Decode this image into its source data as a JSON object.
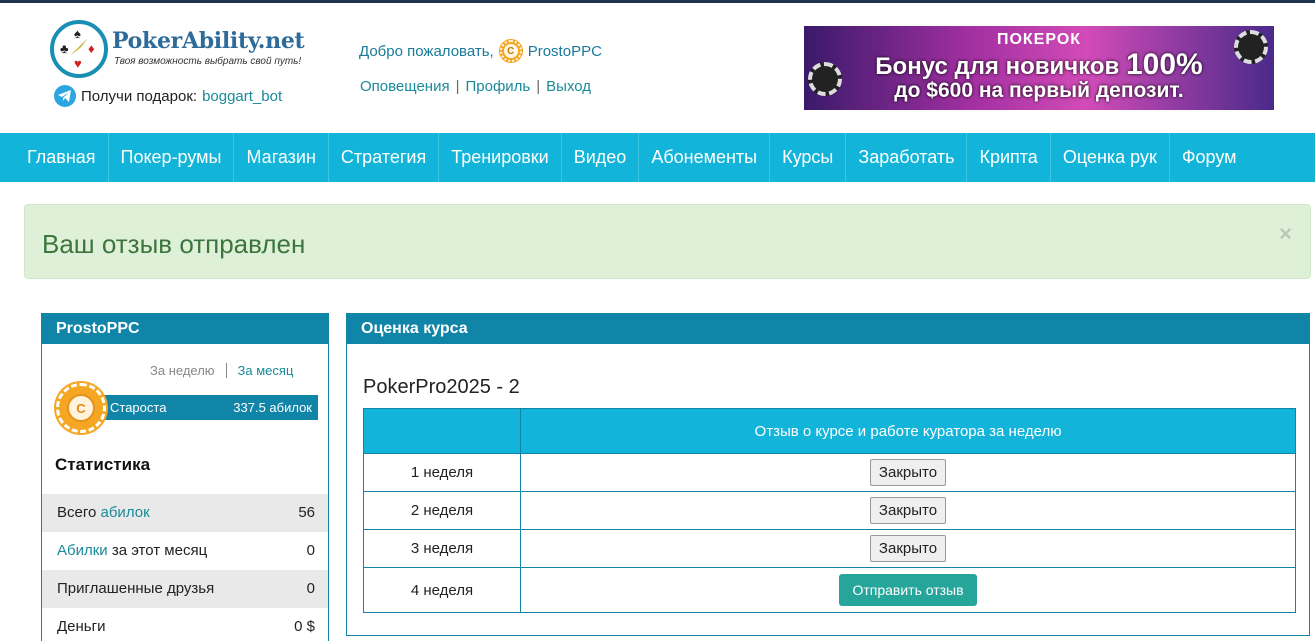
{
  "logo": {
    "title": "PokerAbility.net",
    "subtitle": "Твоя возможность выбрать свой путь!"
  },
  "gift": {
    "label": "Получи подарок:",
    "bot": "boggart_bot",
    "icon": "telegram-icon"
  },
  "user": {
    "welcome": "Добро пожаловать,",
    "name": "ProstoPPC",
    "rank_icon_letter": "C",
    "links": [
      "Оповещения",
      "Профиль",
      "Выход"
    ]
  },
  "banner": {
    "brand": "ПОКЕРОК",
    "line1_text": "Бонус для новичков",
    "line1_big": "100%",
    "line2": "до $600 на первый депозит."
  },
  "nav": [
    "Главная",
    "Покер-румы",
    "Магазин",
    "Стратегия",
    "Тренировки",
    "Видео",
    "Абонементы",
    "Курсы",
    "Заработать",
    "Крипта",
    "Оценка рук",
    "Форум"
  ],
  "alert": {
    "text": "Ваш отзыв отправлен",
    "close": "×"
  },
  "sidebar": {
    "title": "ProstoPPC",
    "period_week": "За неделю",
    "period_month": "За месяц",
    "rank_name": "Староста",
    "rank_value": "337.5 абилок",
    "stats_title": "Статистика",
    "stats": [
      {
        "prefix": "Всего ",
        "link": "абилок",
        "suffix": "",
        "value": "56"
      },
      {
        "prefix": "",
        "link": "Абилки",
        "suffix": " за этот месяц",
        "value": "0"
      },
      {
        "prefix": "Приглашенные друзья",
        "link": "",
        "suffix": "",
        "value": "0"
      },
      {
        "prefix": "Деньги",
        "link": "",
        "suffix": "",
        "value": "0 $"
      }
    ]
  },
  "course": {
    "panel_title": "Оценка курса",
    "name": "PokerPro2025 - 2",
    "column_header": "Отзыв о курсе и работе куратора за неделю",
    "weeks": [
      {
        "label": "1 неделя",
        "action": "Закрыто"
      },
      {
        "label": "2 неделя",
        "action": "Закрыто"
      },
      {
        "label": "3 неделя",
        "action": "Закрыто"
      },
      {
        "label": "4 неделя",
        "action": "Отправить отзыв"
      }
    ]
  },
  "colors": {
    "nav": "#12b5d9",
    "panel_header": "#1185a8",
    "alert_bg": "#dff0d8",
    "alert_text": "#3c763d",
    "send_button": "#26a69a"
  }
}
